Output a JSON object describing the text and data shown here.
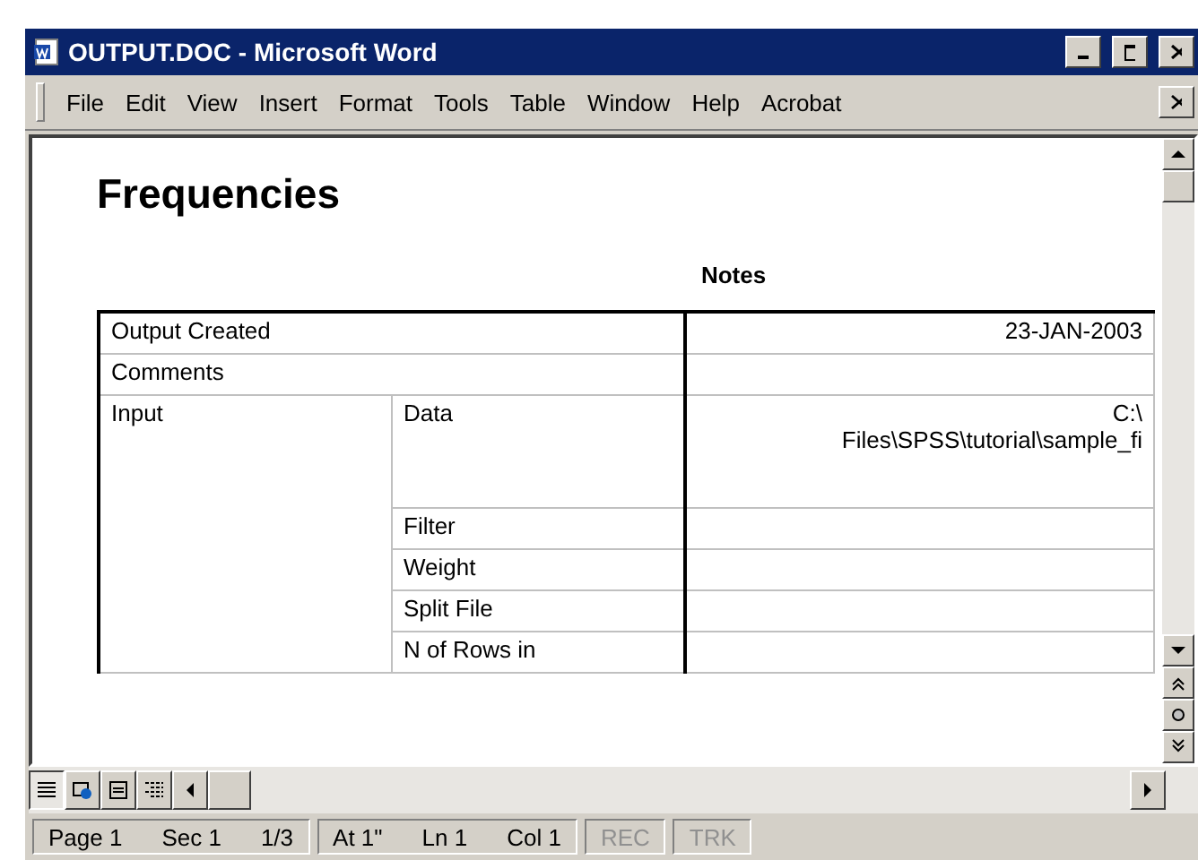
{
  "window": {
    "title": "OUTPUT.DOC - Microsoft Word"
  },
  "menu": [
    "File",
    "Edit",
    "View",
    "Insert",
    "Format",
    "Tools",
    "Table",
    "Window",
    "Help",
    "Acrobat"
  ],
  "document": {
    "heading": "Frequencies",
    "table_title": "Notes",
    "rows": [
      {
        "label": "Output Created",
        "value": "23-JAN-2003"
      },
      {
        "label": "Comments"
      },
      {
        "label": "Input",
        "sublabel": "Data",
        "value": "C:\\",
        "value_2": "Files\\SPSS\\tutorial\\sample_fi"
      },
      {
        "sublabel": "Filter"
      },
      {
        "sublabel": "Weight"
      },
      {
        "sublabel": "Split File"
      },
      {
        "sublabel": "N of Rows in"
      }
    ]
  },
  "view_buttons": [
    {
      "kind": "normal",
      "selected": true
    },
    {
      "kind": "web",
      "selected": false
    },
    {
      "kind": "print",
      "selected": false
    },
    {
      "kind": "outline",
      "selected": false
    }
  ],
  "status_bar": [
    {
      "text": "Page 1",
      "disabled": false
    },
    {
      "text": "Sec 1",
      "disabled": false
    },
    {
      "text": "1/3",
      "disabled": false
    },
    {
      "text": "At 1\"",
      "disabled": false
    },
    {
      "text": "Ln 1",
      "disabled": false
    },
    {
      "text": "Col 1",
      "disabled": false
    },
    {
      "text": "REC",
      "disabled": true
    },
    {
      "text": "TRK",
      "disabled": true
    }
  ]
}
